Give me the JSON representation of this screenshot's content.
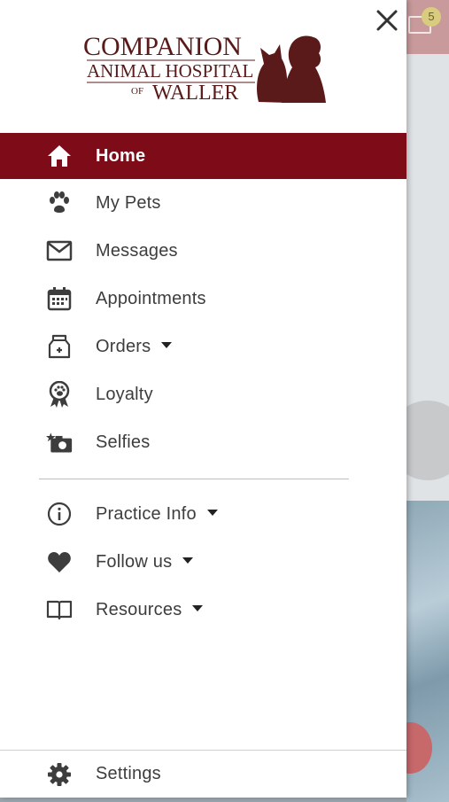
{
  "logo": {
    "line1": "COMPANION",
    "line2": "ANIMAL HOSPITAL",
    "line3_prefix": "OF",
    "line3": "WALLER"
  },
  "background": {
    "badge_count": "5"
  },
  "menu": {
    "items": [
      {
        "label": "Home",
        "icon": "home-icon",
        "active": true
      },
      {
        "label": "My Pets",
        "icon": "paw-icon"
      },
      {
        "label": "Messages",
        "icon": "envelope-icon"
      },
      {
        "label": "Appointments",
        "icon": "calendar-icon"
      },
      {
        "label": "Orders",
        "icon": "medicine-bag-icon",
        "expandable": true
      },
      {
        "label": "Loyalty",
        "icon": "award-ribbon-icon"
      },
      {
        "label": "Selfies",
        "icon": "camera-icon"
      }
    ],
    "secondary": [
      {
        "label": "Practice Info",
        "icon": "info-icon",
        "expandable": true
      },
      {
        "label": "Follow us",
        "icon": "heart-icon",
        "expandable": true
      },
      {
        "label": "Resources",
        "icon": "book-icon",
        "expandable": true
      }
    ],
    "settings": {
      "label": "Settings",
      "icon": "gear-icon"
    }
  },
  "colors": {
    "accent": "#7d0c18",
    "text": "#3d3d3d"
  }
}
